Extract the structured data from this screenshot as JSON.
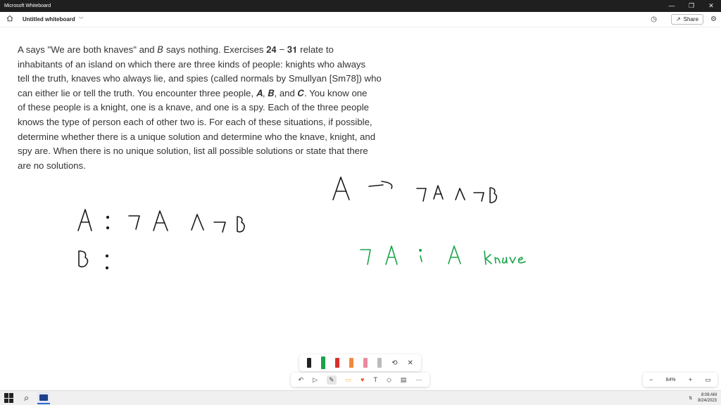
{
  "window": {
    "title": "Microsoft Whiteboard",
    "controls": {
      "minimize": "—",
      "restore": "❐",
      "close": "✕"
    }
  },
  "appbar": {
    "home_icon": "home-icon",
    "board_title": "Untitled whiteboard",
    "chevron": "﹀",
    "timer_icon": "◷",
    "share_icon": "↗",
    "share_label": "Share",
    "settings_icon": "⚙"
  },
  "problem_text": {
    "line1": "A says \"We are both knaves\" and 𝘉 says nothing. Exercises 𝟐𝟒 − 𝟑𝟏 relate to",
    "line2": "inhabitants of an island on which there are three kinds of people: knights who always",
    "line3": "tell the truth, knaves who always lie, and spies (called normals by Smullyan [Sm78]) who",
    "line4": "can either lie or tell the truth. You encounter three people, 𝑨, 𝑩, and 𝑪. You know one",
    "line5": "of these people is a knight, one is a knave, and one is a spy. Each of the three people",
    "line6": "knows the type of person each of other two is. For each of these situations, if possible,",
    "line7": "determine whether there is a unique solution and determine who the knave, knight, and",
    "line8": "spy are. When there is no unique solution, list all possible solutions or state that there",
    "line9": "are no solutions."
  },
  "handwriting": {
    "black_line1": "A : ¬A ∧ ¬B",
    "black_line2": "B :",
    "black_right": "A → ¬A ∧ ¬B",
    "green_line": "¬A ; A Knave",
    "ink_black": "#1a1a1a",
    "ink_green": "#1aa34a"
  },
  "pen_tray": {
    "pens": [
      {
        "name": "black-pen",
        "color": "#222222"
      },
      {
        "name": "green-pen",
        "color": "#1aa34a"
      },
      {
        "name": "red-pen",
        "color": "#d9302c"
      },
      {
        "name": "orange-highlighter",
        "color": "#f08a3c"
      },
      {
        "name": "pink-eraser",
        "color": "#e88aa0"
      },
      {
        "name": "ruler",
        "color": "#bbbbbb"
      }
    ],
    "lasso_icon": "⟲",
    "close_icon": "✕"
  },
  "tools": {
    "undo": "↶",
    "select": "▷",
    "pen": "✎",
    "note": "▭",
    "reaction": "♥",
    "text": "T",
    "shapes": "◇",
    "templates": "▤",
    "more": "⋯",
    "note_color": "#f3b43a",
    "reaction_color": "#e4572e"
  },
  "zoom": {
    "zoom_out": "−",
    "level": "84%",
    "zoom_in": "+",
    "fit": "▭"
  },
  "taskbar": {
    "search_icon": "⌕",
    "tray_icon": "⇅",
    "time": "8:08 AM",
    "date": "8/24/2023"
  }
}
